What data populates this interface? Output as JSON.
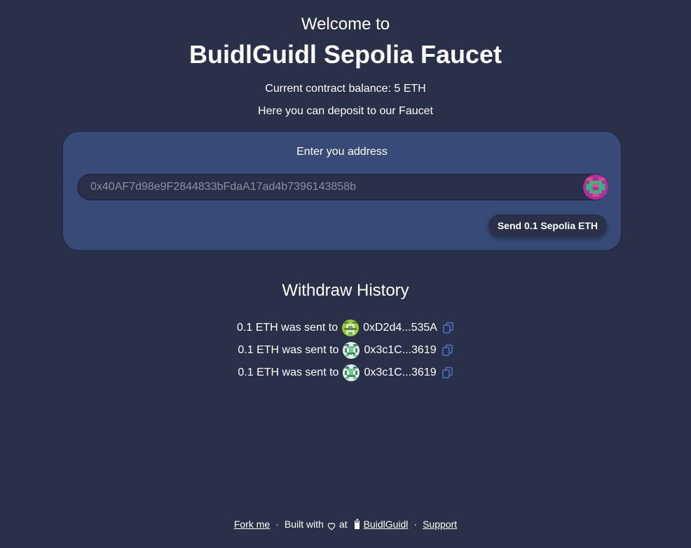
{
  "header": {
    "welcome": "Welcome to",
    "title": "BuidlGuidl Sepolia Faucet",
    "balance": "Current contract balance: 5 ETH",
    "deposit_text": "Here you can deposit to our Faucet"
  },
  "form": {
    "label": "Enter you address",
    "address_placeholder": "0x40AF7d98e9F2844833bFdaA17ad4b7396143858b",
    "send_label": "Send 0.1 Sepolia ETH"
  },
  "history": {
    "title": "Withdraw History",
    "rows": [
      {
        "text": "0.1 ETH was sent to",
        "address": "0xD2d4...535A"
      },
      {
        "text": "0.1 ETH was sent to",
        "address": "0x3c1C...3619"
      },
      {
        "text": "0.1 ETH was sent to",
        "address": "0x3c1C...3619"
      }
    ]
  },
  "footer": {
    "fork": "Fork me",
    "sep": "·",
    "built_with": "Built with",
    "at": "at",
    "buidlguidl": "BuidlGuidl",
    "support": "Support"
  },
  "colors": {
    "background": "#2a3049",
    "card": "#374a78",
    "copy_icon": "#4a74c9"
  },
  "icons": [
    "blockie-avatar-icon",
    "copy-icon",
    "heart-icon",
    "castle-icon"
  ]
}
